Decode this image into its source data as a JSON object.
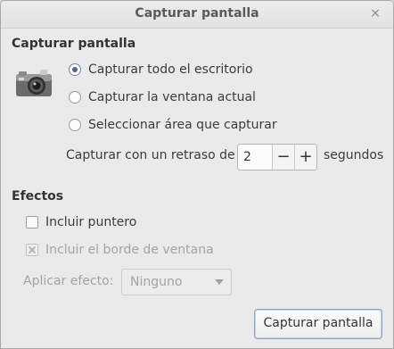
{
  "window": {
    "title": "Capturar pantalla",
    "close_icon": "×"
  },
  "capture": {
    "section_title": "Capturar pantalla",
    "icon": "camera-icon",
    "options": [
      {
        "label": "Capturar todo el escritorio",
        "selected": true
      },
      {
        "label": "Capturar la ventana actual",
        "selected": false
      },
      {
        "label": "Seleccionar área que capturar",
        "selected": false
      }
    ],
    "delay": {
      "label": "Capturar con un retraso de",
      "value": "2",
      "minus": "−",
      "plus": "+",
      "unit": "segundos"
    }
  },
  "effects": {
    "section_title": "Efectos",
    "include_pointer": {
      "label": "Incluir puntero",
      "checked": false
    },
    "include_border": {
      "label": "Incluir el borde de ventana",
      "disabled": true
    },
    "apply_effect": {
      "label": "Aplicar efecto:",
      "value": "Ninguno",
      "disabled": true
    }
  },
  "actions": {
    "capture_button": "Capturar pantalla"
  },
  "colors": {
    "accent": "#4a6590",
    "background": "#eaeaea"
  }
}
